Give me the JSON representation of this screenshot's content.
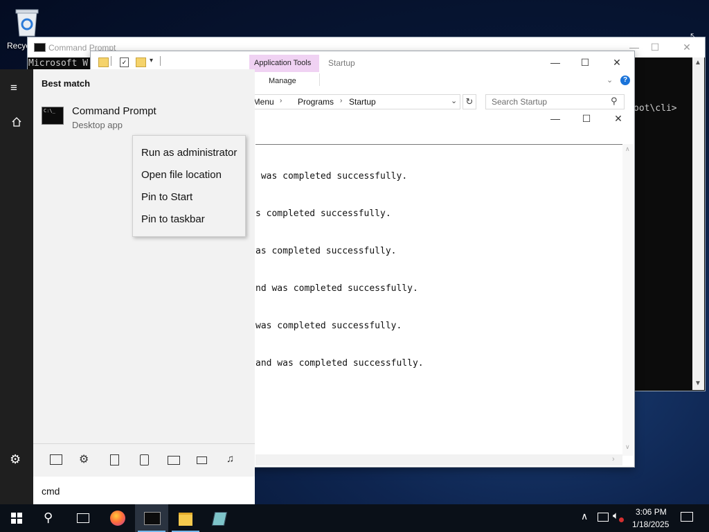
{
  "desktop": {
    "recycle_bin_label": "Recyc"
  },
  "cmd": {
    "title": "Command Prompt",
    "line1": "Microsoft W",
    "path_tail": "oot\\cli>"
  },
  "explorer": {
    "ribbon_tab_app_tools": "Application Tools",
    "ribbon_title": "Startup",
    "ribbon_manage": "Manage",
    "address": {
      "part1": "t Menu",
      "part2": "Programs",
      "part3": "Startup"
    },
    "search_placeholder": "Search Startup",
    "output_lines": [
      " was completed successfully.",
      "s completed successfully.",
      "as completed successfully.",
      "nd was completed successfully.",
      "was completed successfully.",
      "and was completed successfully."
    ]
  },
  "start_menu": {
    "best_match_heading": "Best match",
    "result_title": "Command Prompt",
    "result_subtitle": "Desktop app",
    "search_query": "cmd",
    "context_menu": [
      "Run as administrator",
      "Open file location",
      "Pin to Start",
      "Pin to taskbar"
    ]
  },
  "taskbar": {
    "time": "3:06 PM",
    "date": "1/18/2025"
  },
  "colors": {
    "accent": "#76b9ed",
    "app_tools_tab": "#f0d2f3"
  }
}
